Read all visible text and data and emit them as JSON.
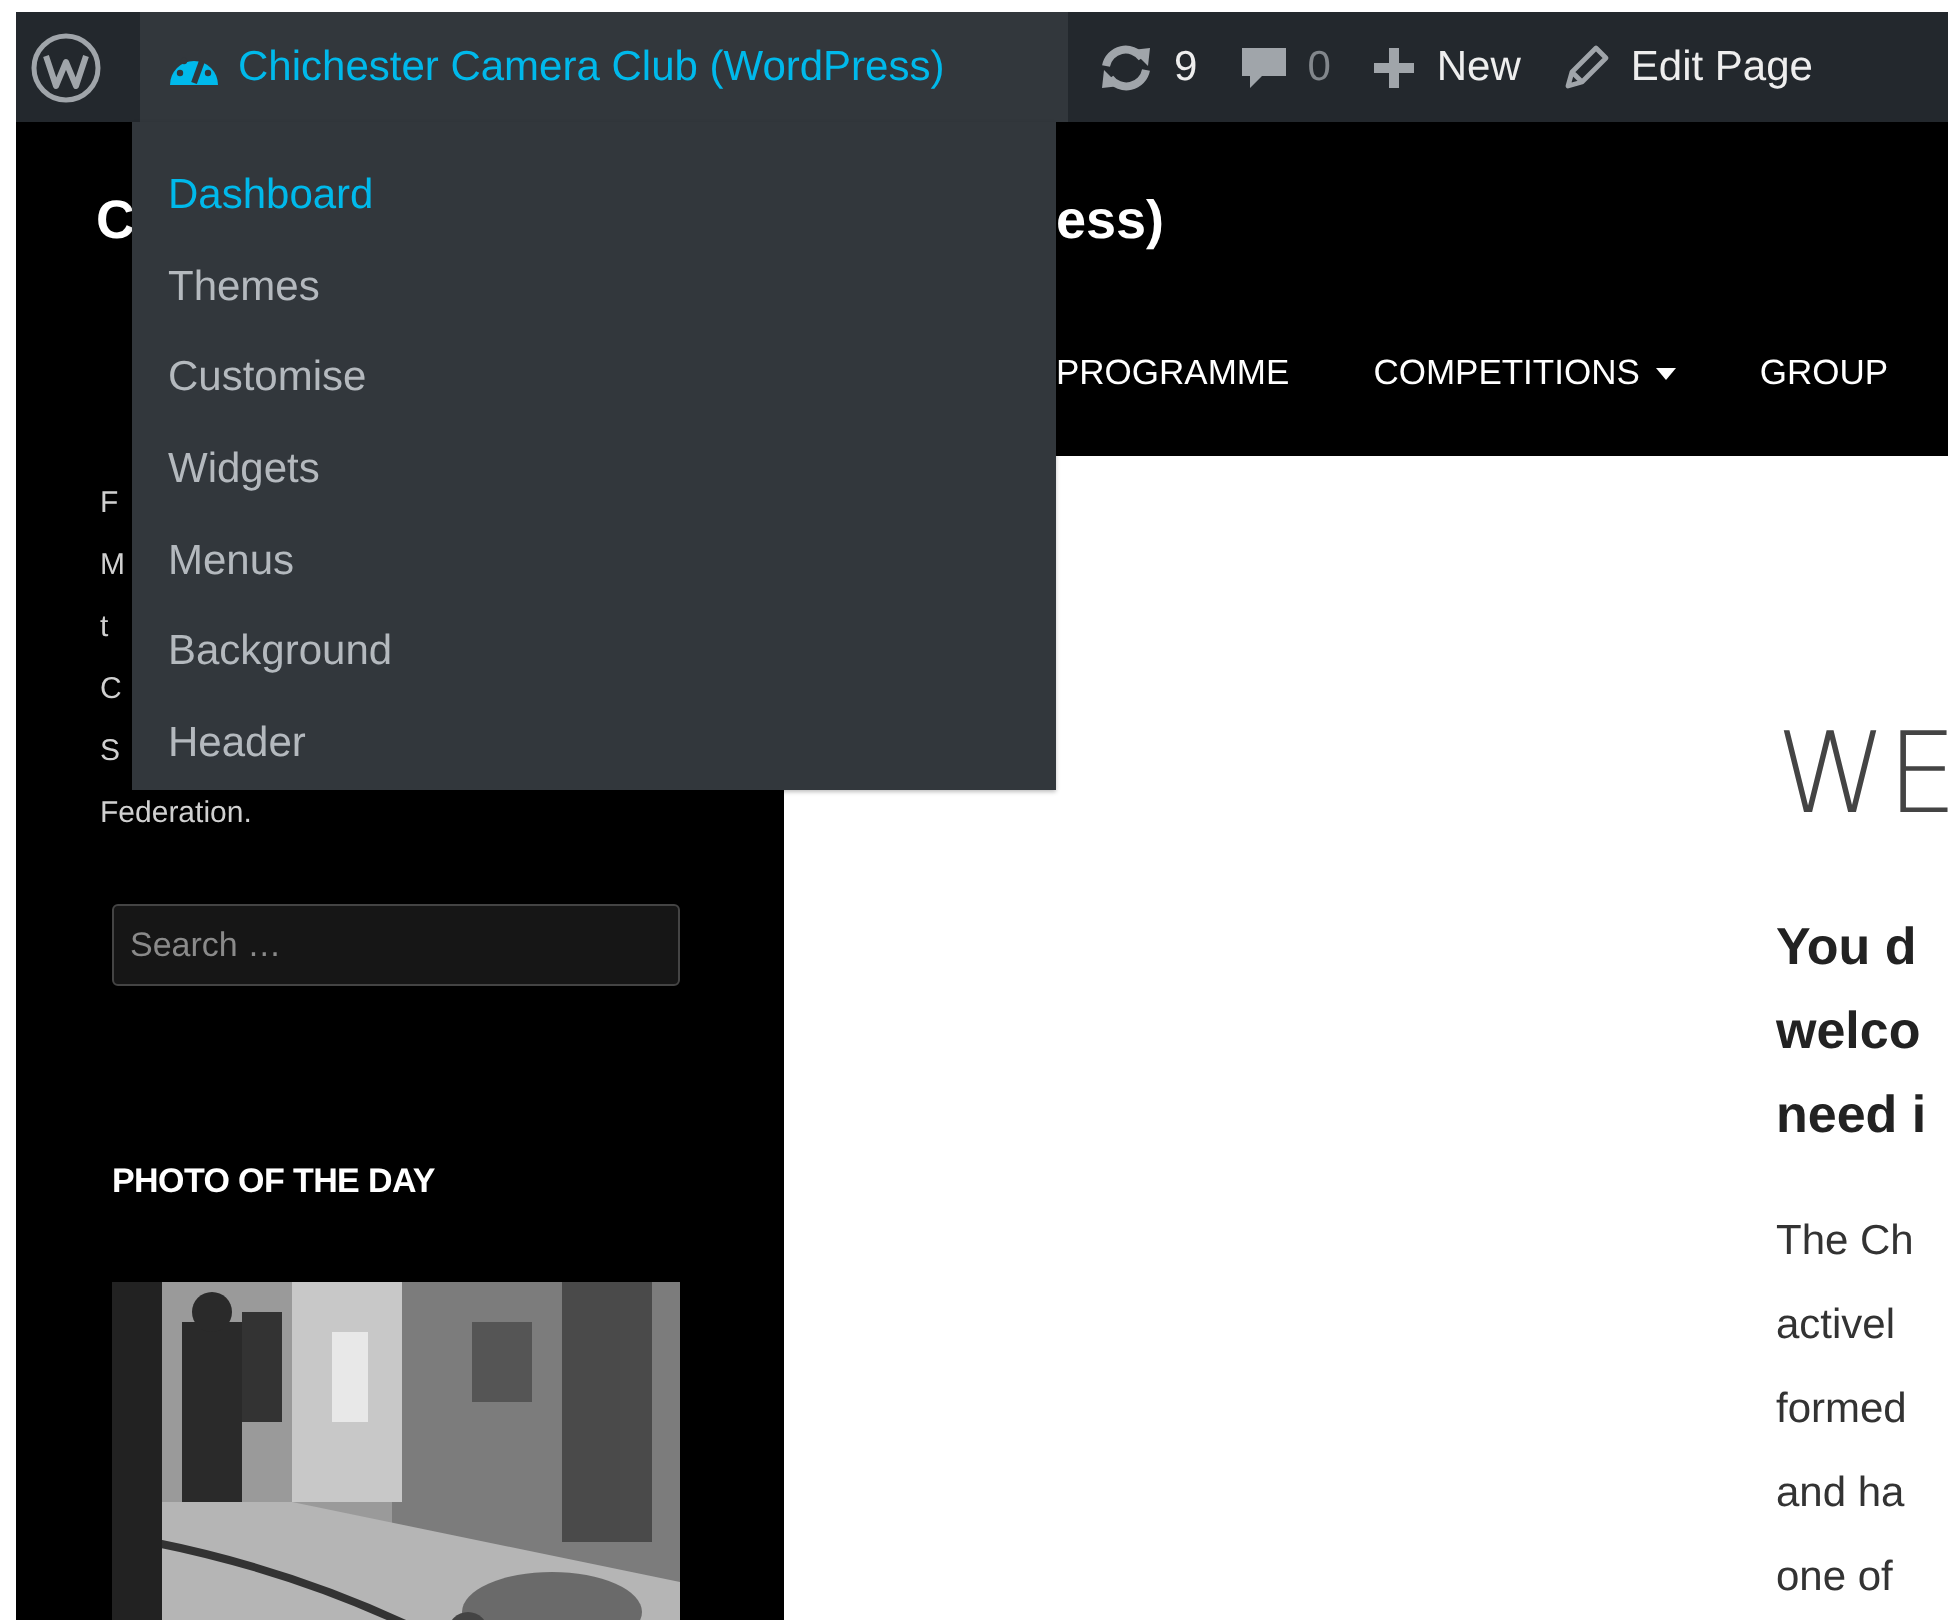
{
  "admin_bar": {
    "items": [
      {
        "kind": "logo",
        "selected": false
      },
      {
        "kind": "site",
        "label": "Chichester Camera Club (WordPress)",
        "selected": true
      },
      {
        "kind": "updates",
        "label": "9",
        "selected": false
      },
      {
        "kind": "comments",
        "label": "0",
        "selected": false
      },
      {
        "kind": "new",
        "label": "New",
        "selected": false
      },
      {
        "kind": "edit",
        "label": "Edit Page",
        "selected": false
      }
    ]
  },
  "site_menu": {
    "items": [
      {
        "label": "Dashboard",
        "selected": true
      },
      {
        "label": "Themes",
        "selected": false
      },
      {
        "label": "Customise",
        "selected": false
      },
      {
        "label": "Widgets",
        "selected": false
      },
      {
        "label": "Menus",
        "selected": false
      },
      {
        "label": "Background",
        "selected": false
      },
      {
        "label": "Header",
        "selected": false
      }
    ]
  },
  "header": {
    "title_parts": [
      "C",
      "ess)"
    ],
    "nav": [
      {
        "label": "PROGRAMME",
        "dropdown": false
      },
      {
        "label": "COMPETITIONS",
        "dropdown": true
      },
      {
        "label": "GROUP",
        "dropdown": false
      }
    ]
  },
  "sidebar": {
    "text_lines": [
      "F",
      "M",
      "t",
      "C",
      "S",
      "Federation."
    ],
    "search": {
      "placeholder": "Search …"
    },
    "widget_title": "PHOTO OF THE DAY",
    "photo": {
      "kind": "picture"
    }
  },
  "main": {
    "title": "WE",
    "lead_lines": [
      "You d",
      "welco",
      "need i"
    ],
    "body_lines": [
      "The Ch",
      "activel",
      "formed",
      "and ha",
      "one of"
    ]
  }
}
